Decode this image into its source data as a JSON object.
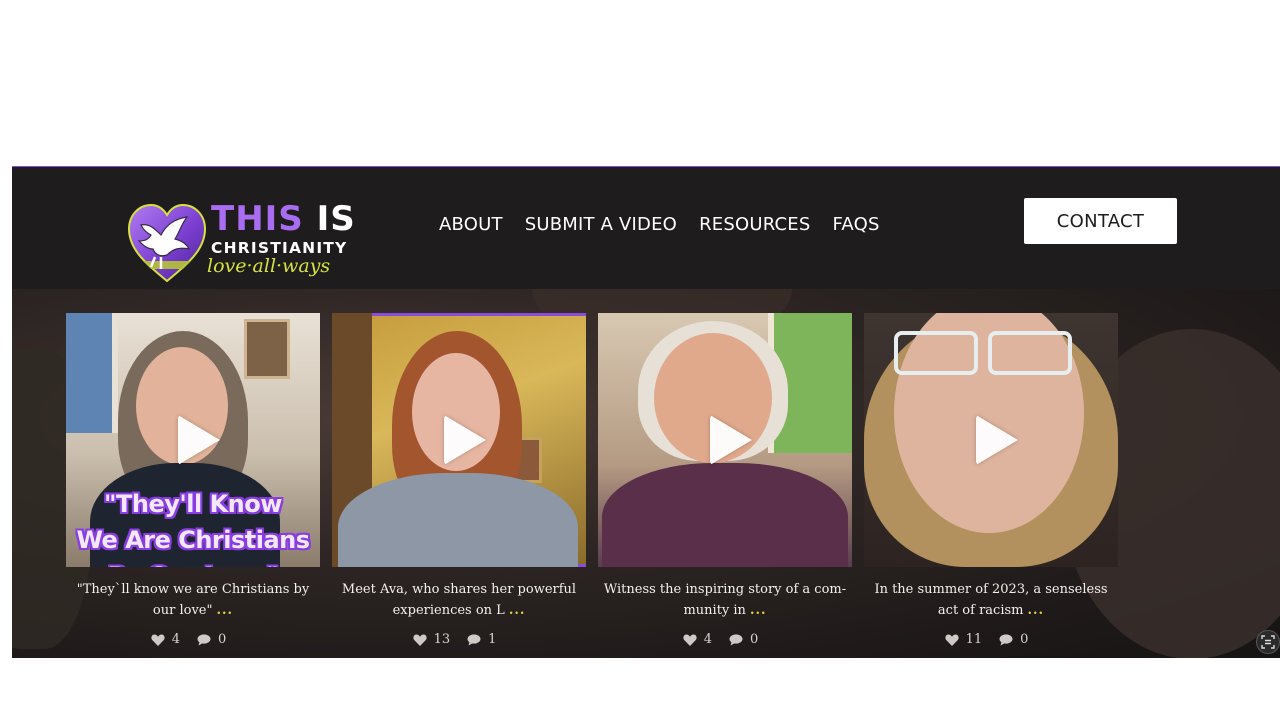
{
  "brand": {
    "word1": "THIS",
    "word2": "IS",
    "line2": "CHRISTIANITY",
    "tagline": "love·all·ways",
    "accent_color": "#8a4ddb",
    "tagline_color": "#d6e23a"
  },
  "nav": {
    "items": [
      {
        "label": "ABOUT"
      },
      {
        "label": "SUBMIT A VIDEO"
      },
      {
        "label": "RESOURCES"
      },
      {
        "label": "FAQS"
      }
    ],
    "contact_label": "CONTACT"
  },
  "videos": [
    {
      "overlay_line1": "\"They'll Know",
      "overlay_line2": "We Are Christians",
      "overlay_line3": "By Our Love\"",
      "caption": "\"They`ll know we are Christians by our love\"",
      "more": "...",
      "likes": "4",
      "comments": "0"
    },
    {
      "caption": "Meet Ava, who shares her powerful experiences on L",
      "more": "...",
      "likes": "13",
      "comments": "1"
    },
    {
      "caption": "Witness the inspiring story of a com- munity in",
      "more": "...",
      "likes": "4",
      "comments": "0"
    },
    {
      "caption": "In the summer of 2023, a senseless act of racism",
      "more": "...",
      "likes": "11",
      "comments": "0"
    }
  ],
  "icons": {
    "like": "heart-icon",
    "comment": "speech-bubble-icon",
    "play": "play-icon",
    "scan": "scan-icon"
  }
}
